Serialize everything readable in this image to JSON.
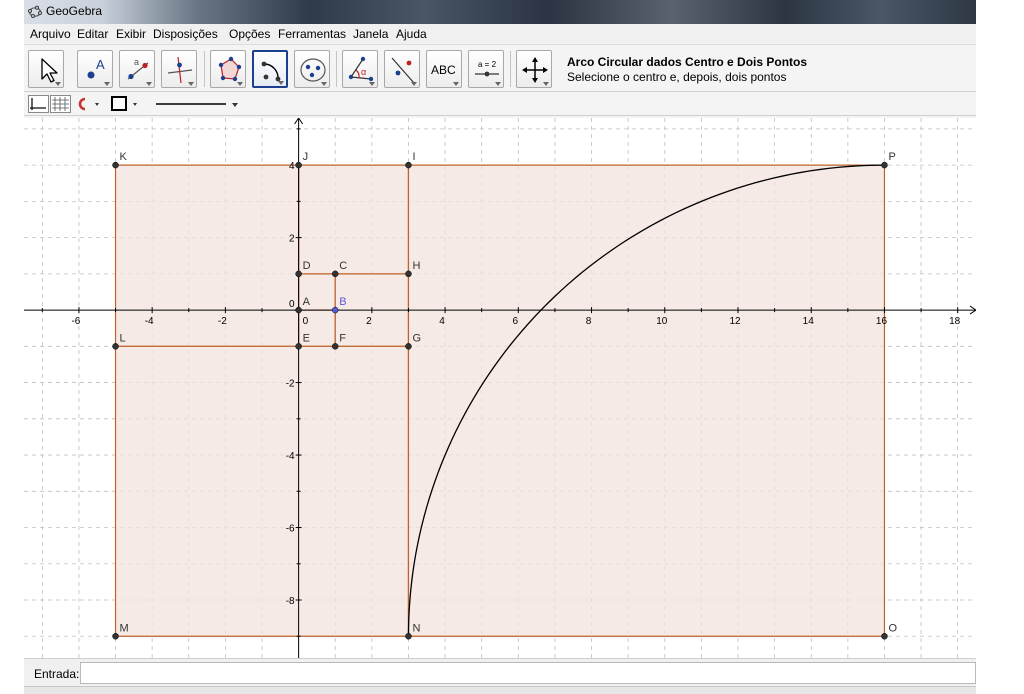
{
  "window": {
    "title": "GeoGebra"
  },
  "menu": [
    {
      "label": "Arquivo"
    },
    {
      "label": "Editar"
    },
    {
      "label": "Exibir"
    },
    {
      "label": "Disposições"
    },
    {
      "label": "Opções"
    },
    {
      "label": "Ferramentas"
    },
    {
      "label": "Janela"
    },
    {
      "label": "Ajuda"
    }
  ],
  "toolbar": {
    "tools": [
      {
        "name": "move-tool-icon",
        "selected": false
      },
      {
        "name": "new-point-tool-icon",
        "selected": false,
        "text": "A"
      },
      {
        "name": "line-through-two-points-tool-icon",
        "selected": false,
        "text": "a"
      },
      {
        "name": "perpendicular-line-tool-icon",
        "selected": false
      },
      {
        "name": "polygon-tool-icon",
        "selected": false
      },
      {
        "name": "circular-arc-tool-icon",
        "selected": true
      },
      {
        "name": "conic-through-five-points-tool-icon",
        "selected": false
      },
      {
        "name": "angle-tool-icon",
        "selected": false,
        "text": "α"
      },
      {
        "name": "reflect-about-line-tool-icon",
        "selected": false
      },
      {
        "name": "insert-text-tool-icon",
        "selected": false,
        "text": "ABC"
      },
      {
        "name": "slider-tool-icon",
        "selected": false,
        "text": "a = 2"
      },
      {
        "name": "move-graphics-view-tool-icon",
        "selected": false
      }
    ],
    "help_title": "Arco Circular dados Centro e Dois Pontos",
    "help_desc": "Selecione o centro e, depois, dois pontos"
  },
  "graphics": {
    "x_range": [
      -7.5,
      18.5
    ],
    "y_range": [
      -9.6,
      5.3
    ],
    "grid": true,
    "axes": true,
    "x_tick_labels": [
      -6,
      -4,
      -2,
      0,
      2,
      4,
      6,
      8,
      10,
      12,
      14,
      16,
      18
    ],
    "y_tick_labels": [
      4,
      2,
      0,
      -2,
      -4,
      -6,
      -8
    ],
    "colors": {
      "polygon_stroke": "#c0622a",
      "polygon_fill": "#f2e3dd",
      "point": "#333333",
      "free_point": "#5a5ad6",
      "axis": "#000000",
      "grid": "#c0c0c0",
      "arc": "#000000"
    },
    "points": [
      {
        "label": "A",
        "x": 0,
        "y": 0
      },
      {
        "label": "B",
        "x": 1,
        "y": 0,
        "free": true
      },
      {
        "label": "C",
        "x": 1,
        "y": 1
      },
      {
        "label": "D",
        "x": 0,
        "y": 1
      },
      {
        "label": "E",
        "x": 0,
        "y": -1
      },
      {
        "label": "F",
        "x": 1,
        "y": -1
      },
      {
        "label": "G",
        "x": 3,
        "y": -1
      },
      {
        "label": "H",
        "x": 3,
        "y": 1
      },
      {
        "label": "I",
        "x": 3,
        "y": 4
      },
      {
        "label": "J",
        "x": 0,
        "y": 4
      },
      {
        "label": "K",
        "x": -5,
        "y": 4
      },
      {
        "label": "L",
        "x": -5,
        "y": -1
      },
      {
        "label": "M",
        "x": -5,
        "y": -9
      },
      {
        "label": "N",
        "x": 3,
        "y": -9
      },
      {
        "label": "O",
        "x": 16,
        "y": -9
      },
      {
        "label": "P",
        "x": 16,
        "y": 4
      }
    ],
    "polygons": [
      [
        "A",
        "B",
        "C",
        "D"
      ],
      [
        "E",
        "F",
        "B",
        "A"
      ],
      [
        "F",
        "G",
        "H",
        "C"
      ],
      [
        "D",
        "H",
        "I",
        "J"
      ],
      [
        "K",
        "L",
        "E",
        "J"
      ],
      [
        "M",
        "N",
        "G",
        "L"
      ],
      [
        "N",
        "O",
        "P",
        "I"
      ]
    ],
    "arc": {
      "center": "O",
      "from": "N",
      "to": "P"
    }
  },
  "input": {
    "label": "Entrada:",
    "value": ""
  }
}
